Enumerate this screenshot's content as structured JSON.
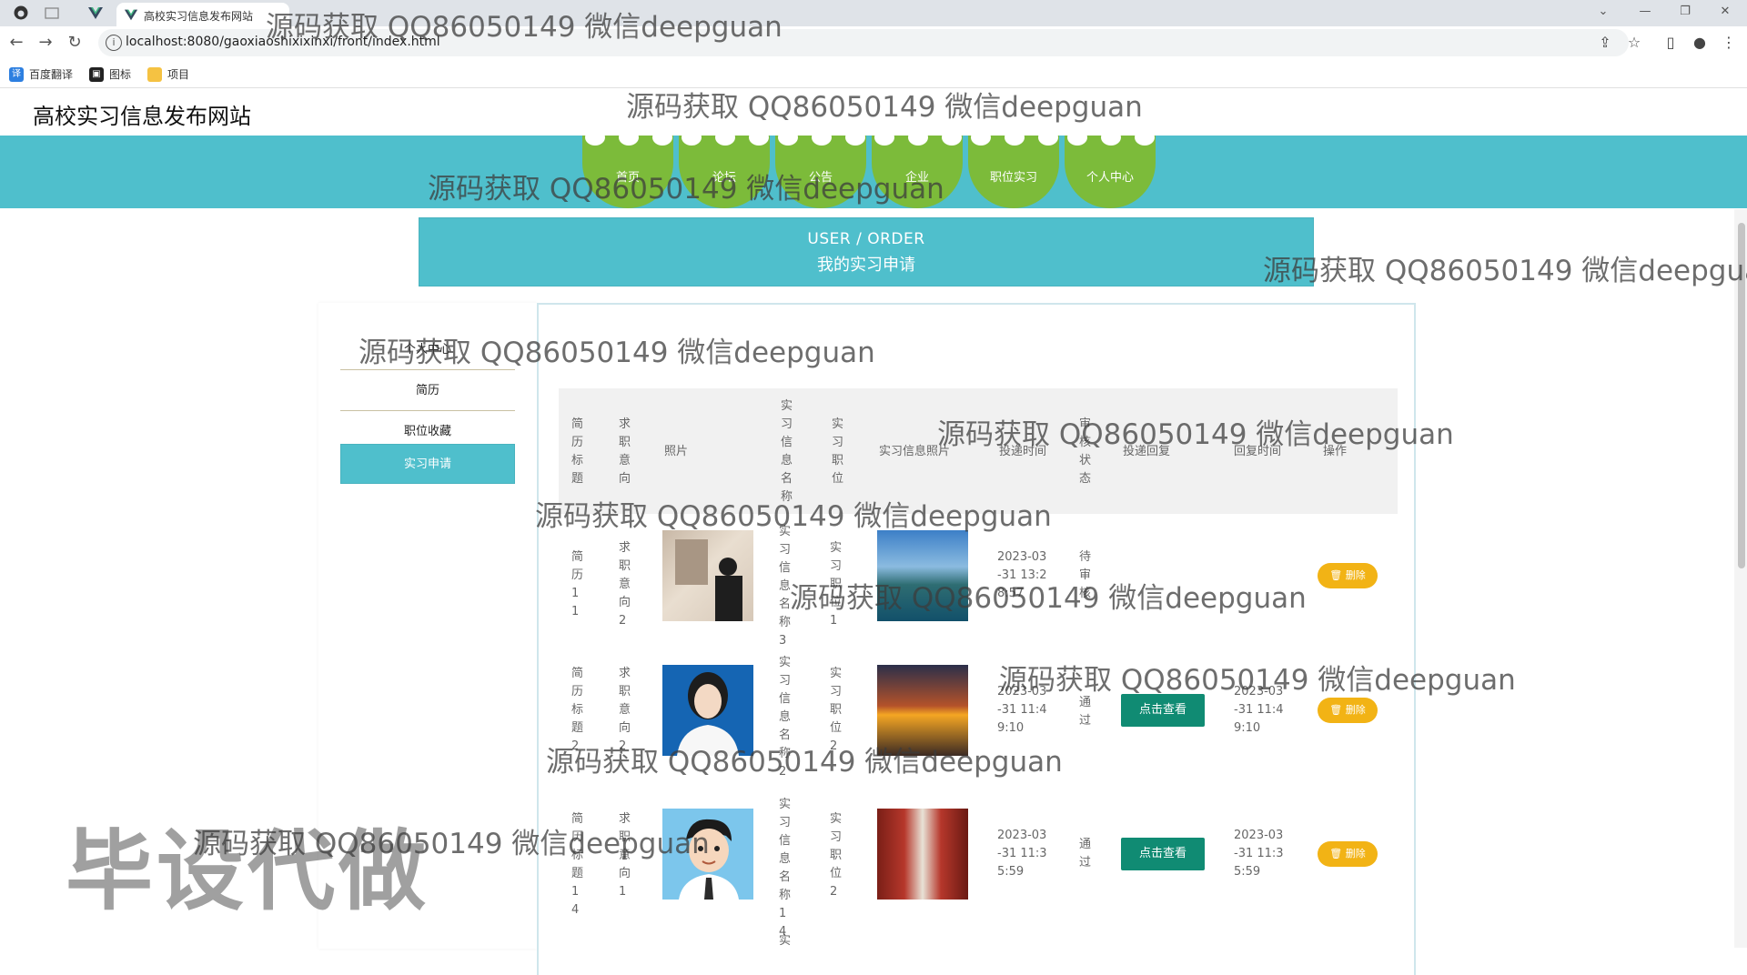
{
  "browser": {
    "tab_title": "高校实习信息发布网站",
    "url": "localhost:8080/gaoxiaoshixixinxi/front/index.html",
    "bookmarks": [
      "百度翻译",
      "图标",
      "项目"
    ]
  },
  "site": {
    "title": "高校实习信息发布网站",
    "nav": [
      "首页",
      "论坛",
      "公告",
      "企业",
      "职位实习",
      "个人中心"
    ]
  },
  "banner": {
    "en": "USER / ORDER",
    "cn": "我的实习申请"
  },
  "menu": {
    "items": [
      "个人中心",
      "简历",
      "职位收藏",
      "实习申请"
    ],
    "active": "实习申请"
  },
  "table": {
    "headers": {
      "resume_title": "简历标题",
      "intention": "求职意向",
      "photo": "照片",
      "internship_name": "实习信息名称",
      "position": "实习职位",
      "internship_photo": "实习信息照片",
      "submit_time": "投递时间",
      "status": "审核状态",
      "reply": "投递回复",
      "reply_time": "回复时间",
      "ops": "操作"
    },
    "rows": [
      {
        "resume_title": "简历11",
        "intention": "求职意向2",
        "internship_name": "实习信息名称3",
        "position": "实习职位1",
        "submit_time": "2023-03-31 13:28:57",
        "status": "待审核",
        "reply": "",
        "reply_time": "",
        "delete_label": "删除"
      },
      {
        "resume_title": "简历标题2",
        "intention": "求职意向2",
        "internship_name": "实习信息名称2",
        "position": "实习职位2",
        "submit_time": "2023-03-31 11:49:10",
        "status": "通过",
        "reply": "点击查看",
        "reply_time": "2023-03-31 11:49:10",
        "delete_label": "删除"
      },
      {
        "resume_title": "简历标题14",
        "intention": "求职意向1",
        "internship_name": "实习信息名称14",
        "position": "实习职位2",
        "submit_time": "2023-03-31 11:35:59",
        "status": "通过",
        "reply": "点击查看",
        "reply_time": "2023-03-31 11:35:59",
        "delete_label": "删除"
      }
    ],
    "partial_next_row": "实"
  },
  "watermark": {
    "text": "源码获取 QQ86050149 微信deepguan",
    "big_text": "毕设代做"
  },
  "colors": {
    "teal": "#4fbfcc",
    "green_nav": "#7cbb3a",
    "btn_green": "#108b73",
    "btn_yellow": "#f2b315"
  }
}
